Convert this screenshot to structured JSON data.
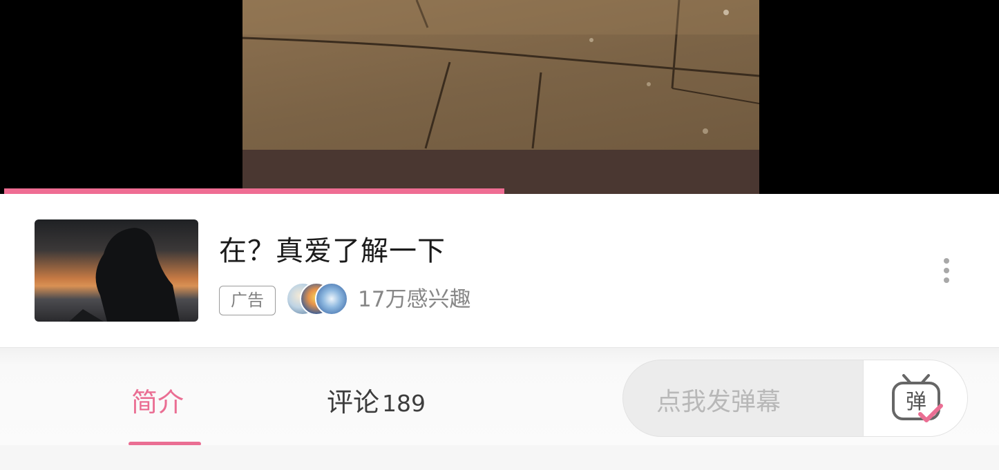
{
  "video": {
    "progress_percent": 50.5,
    "colors": {
      "progress": "#ef6d93",
      "background": "#000000"
    }
  },
  "ad": {
    "title": "在？真爱了解一下",
    "tag": "广告",
    "interest": "17万感兴趣",
    "more_icon": "more-vertical-icon"
  },
  "tabs": {
    "intro_label": "简介",
    "comments_label": "评论",
    "comments_count": "189",
    "accent": "#ea6e93"
  },
  "danmaku": {
    "placeholder": "点我发弹幕",
    "button_glyph": "弹",
    "button_icon": "danmaku-tv-icon"
  }
}
